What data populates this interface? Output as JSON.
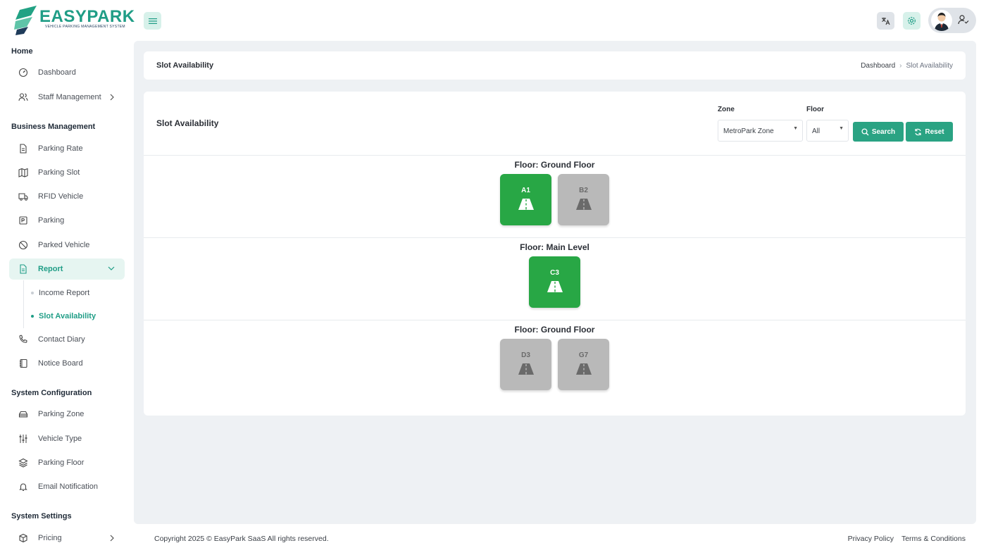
{
  "brand": {
    "name": "EASYPARK",
    "tagline": "VEHICLE PARKING MANAGEMENT SYSTEM"
  },
  "sidebar": {
    "sections": [
      {
        "title": "Home",
        "items": [
          {
            "label": "Dashboard",
            "icon": "dashboard-icon"
          },
          {
            "label": "Staff Management",
            "icon": "users-icon",
            "has_arrow": true
          }
        ]
      },
      {
        "title": "Business Management",
        "items": [
          {
            "label": "Parking Rate",
            "icon": "document-icon"
          },
          {
            "label": "Parking Slot",
            "icon": "map-icon"
          },
          {
            "label": "RFID Vehicle",
            "icon": "truck-icon"
          },
          {
            "label": "Parking",
            "icon": "parking-icon"
          },
          {
            "label": "Parked Vehicle",
            "icon": "ban-icon"
          },
          {
            "label": "Report",
            "icon": "report-icon",
            "active": true,
            "expanded": true,
            "children": [
              {
                "label": "Income Report"
              },
              {
                "label": "Slot Availability",
                "active": true
              }
            ]
          },
          {
            "label": "Contact Diary",
            "icon": "phone-icon"
          },
          {
            "label": "Notice Board",
            "icon": "notebook-icon"
          }
        ]
      },
      {
        "title": "System Configuration",
        "items": [
          {
            "label": "Parking Zone",
            "icon": "car-icon"
          },
          {
            "label": "Vehicle Type",
            "icon": "sliders-icon"
          },
          {
            "label": "Parking Floor",
            "icon": "layers-icon"
          },
          {
            "label": "Email Notification",
            "icon": "bell-icon"
          }
        ]
      },
      {
        "title": "System Settings",
        "items": [
          {
            "label": "Pricing",
            "icon": "box-icon",
            "has_arrow": true
          }
        ]
      }
    ]
  },
  "page": {
    "title": "Slot Availability",
    "breadcrumb": [
      "Dashboard",
      "Slot Availability"
    ]
  },
  "filters": {
    "title": "Slot Availability",
    "zone_label": "Zone",
    "zone_value": "MetroPark Zone",
    "floor_label": "Floor",
    "floor_value": "All",
    "search_label": "Search",
    "reset_label": "Reset"
  },
  "floors": [
    {
      "title": "Floor: Ground Floor",
      "slots": [
        {
          "code": "A1",
          "status": "available"
        },
        {
          "code": "B2",
          "status": "occupied"
        }
      ]
    },
    {
      "title": "Floor: Main Level",
      "slots": [
        {
          "code": "C3",
          "status": "available"
        }
      ]
    },
    {
      "title": "Floor: Ground Floor",
      "slots": [
        {
          "code": "D3",
          "status": "occupied"
        },
        {
          "code": "G7",
          "status": "occupied"
        }
      ]
    }
  ],
  "colors": {
    "accent": "#2aa383",
    "available": "#28a745",
    "occupied": "#b9b9b9"
  },
  "footer": {
    "copyright": "Copyright 2025 © EasyPark SaaS All rights reserved.",
    "links": [
      "Privacy Policy",
      "Terms & Conditions"
    ]
  }
}
